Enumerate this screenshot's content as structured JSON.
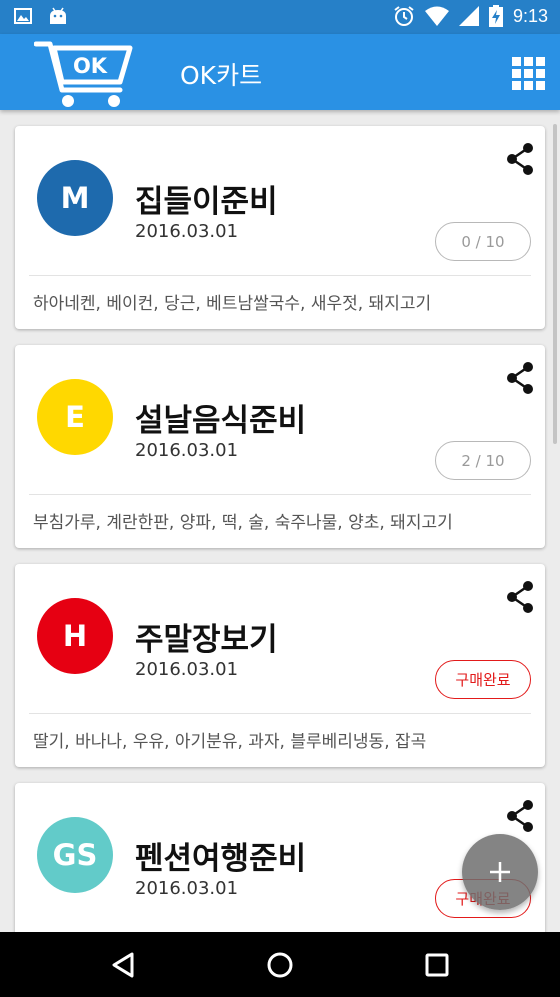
{
  "statusbar": {
    "time": "9:13",
    "icons": [
      "image-icon",
      "android-icon",
      "alarm-icon",
      "wifi-icon",
      "signal-icon",
      "battery-charging-icon"
    ]
  },
  "appbar": {
    "logo_text": "OK",
    "title": "OK카트",
    "menu_icon": "grid-icon"
  },
  "colors": {
    "appbar": "#2a91e4",
    "statusbar": "#2680c8",
    "avatar_m": "#1e6aad",
    "avatar_e": "#ffd800",
    "avatar_h": "#e60012",
    "avatar_gs": "#62cbc9",
    "badge_done": "#e21a1a"
  },
  "lists": [
    {
      "initial": "M",
      "title": "집들이준비",
      "date": "2016.03.01",
      "status": "0 / 10",
      "status_type": "count",
      "items": "하아네켄, 베이컨, 당근, 베트남쌀국수, 새우젓, 돼지고기"
    },
    {
      "initial": "E",
      "title": "설날음식준비",
      "date": "2016.03.01",
      "status": "2 / 10",
      "status_type": "count",
      "items": "부침가루, 계란한판, 양파, 떡, 술, 숙주나물, 양초, 돼지고기"
    },
    {
      "initial": "H",
      "title": "주말장보기",
      "date": "2016.03.01",
      "status": "구매완료",
      "status_type": "done",
      "items": "딸기, 바나나, 우유, 아기분유, 과자, 블루베리냉동, 잡곡"
    },
    {
      "initial": "GS",
      "title": "펜션여행준비",
      "date": "2016.03.01",
      "status": "구매완료",
      "status_type": "done",
      "items": ""
    }
  ],
  "fab": {
    "icon": "plus-icon"
  },
  "navbar": {
    "icons": [
      "back-icon",
      "home-icon",
      "recents-icon"
    ]
  }
}
